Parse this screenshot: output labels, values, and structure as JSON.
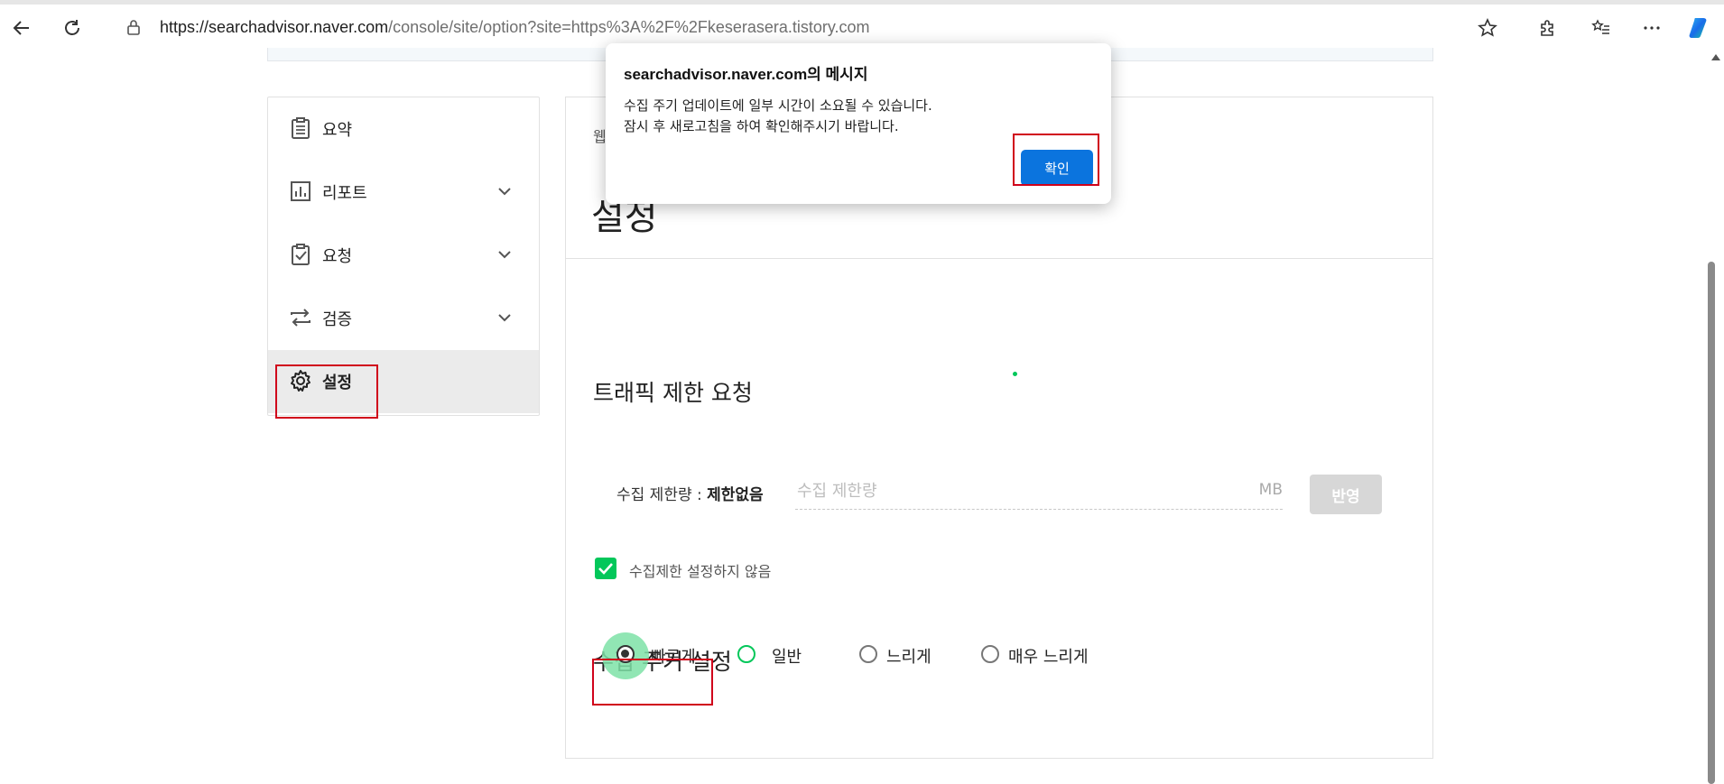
{
  "browser": {
    "url_host": "https://searchadvisor.naver.com",
    "url_rest": "/console/site/option?site=https%3A%2F%2Fkeserasera.tistory.com"
  },
  "sidebar": {
    "items": [
      {
        "label": "요약",
        "icon": "clipboard-icon",
        "expandable": false
      },
      {
        "label": "리포트",
        "icon": "bar-chart-icon",
        "expandable": true
      },
      {
        "label": "요청",
        "icon": "clipboard-check-icon",
        "expandable": true
      },
      {
        "label": "검증",
        "icon": "swap-arrows-icon",
        "expandable": true
      },
      {
        "label": "설정",
        "icon": "gear-icon",
        "expandable": false,
        "active": true
      }
    ]
  },
  "main": {
    "breadcrumb": "웹",
    "title": "설정",
    "traffic": {
      "heading": "트래픽 제한 요청",
      "limit_label": "수집 제한량 : ",
      "limit_value": "제한없음",
      "input_placeholder": "수집 제한량",
      "unit": "MB",
      "apply_label": "반영",
      "checkbox_label": "수집제한 설정하지 않음",
      "checkbox_checked": true
    },
    "crawl": {
      "heading": "수집 주기 설정",
      "options": [
        "빠르게",
        "일반",
        "느리게",
        "매우 느리게"
      ],
      "selected": "빠르게"
    }
  },
  "dialog": {
    "title": "searchadvisor.naver.com의 메시지",
    "line1": "수집 주기 업데이트에 일부 시간이 소요될 수 있습니다.",
    "line2": "잠시 후 새로고침을 하여 확인해주시기 바랍니다.",
    "ok_label": "확인"
  },
  "colors": {
    "naver_green": "#03c75a",
    "dialog_button": "#0b74de",
    "highlight_box": "#d0021b"
  }
}
